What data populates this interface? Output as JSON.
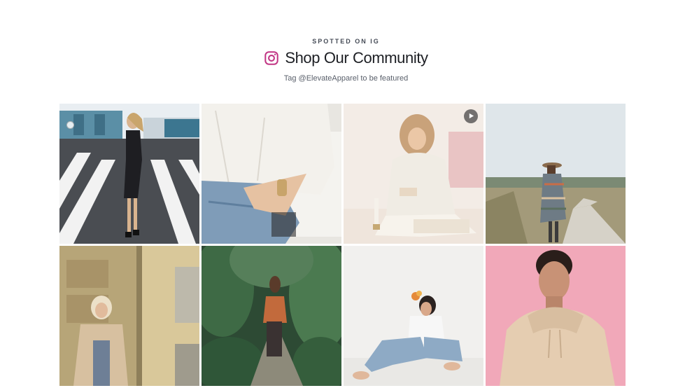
{
  "header": {
    "eyebrow": "SPOTTED ON IG",
    "title": "Shop Our Community",
    "subtitle": "Tag @ElevateApparel to be featured",
    "icon": "instagram-icon",
    "accent": "#c13584"
  },
  "gallery": {
    "posts": [
      {
        "id": "post-1",
        "has_video": false
      },
      {
        "id": "post-2",
        "has_video": false
      },
      {
        "id": "post-3",
        "has_video": true
      },
      {
        "id": "post-4",
        "has_video": false
      },
      {
        "id": "post-5",
        "has_video": false
      },
      {
        "id": "post-6",
        "has_video": false
      },
      {
        "id": "post-7",
        "has_video": false
      },
      {
        "id": "post-8",
        "has_video": false
      }
    ]
  }
}
